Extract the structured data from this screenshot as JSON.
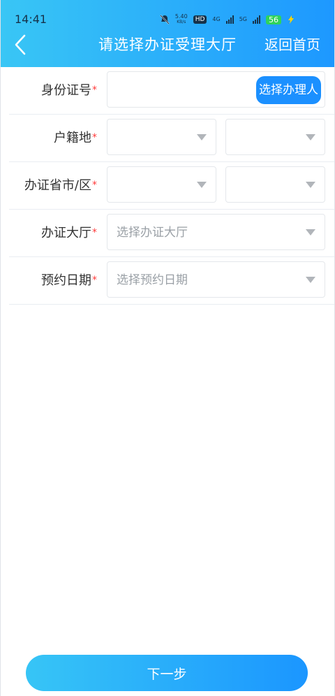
{
  "status_bar": {
    "time": "14:41",
    "network_speed": "5.40",
    "network_unit": "KB/s",
    "hd": "HD",
    "signal_4g": "4G",
    "signal_5g": "5G",
    "battery": "56"
  },
  "nav": {
    "title": "请选择办证受理大厅",
    "home_label": "返回首页"
  },
  "form": {
    "id_number": {
      "label": "身份证号",
      "required_mark": "*",
      "button_label": "选择办理人",
      "value": ""
    },
    "household": {
      "label": "户籍地",
      "required_mark": "*"
    },
    "city_district": {
      "label": "办证省市/区",
      "required_mark": "*"
    },
    "hall": {
      "label": "办证大厅",
      "required_mark": "*",
      "placeholder": "选择办证大厅"
    },
    "date": {
      "label": "预约日期",
      "required_mark": "*",
      "placeholder": "选择预约日期"
    }
  },
  "footer": {
    "next_label": "下一步"
  },
  "colors": {
    "header_start": "#39c6f5",
    "header_end": "#1d98ff",
    "primary": "#1b90ff",
    "required": "#ff3a3a"
  }
}
